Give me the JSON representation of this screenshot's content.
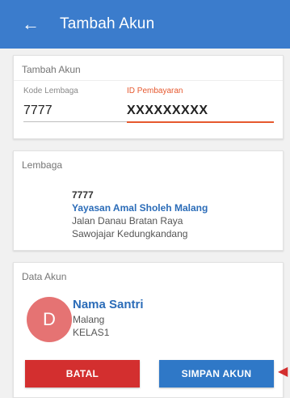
{
  "appbar": {
    "back_icon": "arrow-left-icon",
    "title": "Tambah Akun"
  },
  "form_card": {
    "title": "Tambah Akun",
    "kode_lembaga": {
      "label": "Kode Lembaga",
      "value": "7777"
    },
    "id_pembayaran": {
      "label": "ID Pembayaran",
      "value": "XXXXXXXXX"
    },
    "accent": "#e6582e"
  },
  "lembaga_card": {
    "title": "Lembaga",
    "code": "7777",
    "name": "Yayasan Amal Sholeh Malang",
    "address1": "Jalan Danau Bratan Raya",
    "address2": "Sawojajar Kedungkandang"
  },
  "akun_card": {
    "title": "Data Akun",
    "avatar_letter": "D",
    "name": "Nama Santri",
    "city": "Malang",
    "kelas": "KELAS1"
  },
  "buttons": {
    "batal": "BATAL",
    "simpan": "SIMPAN AKUN"
  },
  "colors": {
    "appbar": "#3b7ccc",
    "batal": "#d32f2f",
    "simpan": "#2f78c7",
    "link": "#2b6cb8"
  }
}
